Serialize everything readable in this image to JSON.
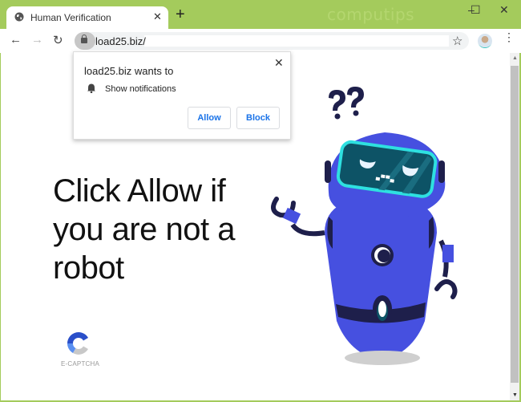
{
  "browser": {
    "tab_title": "Human Verification",
    "tab_close": "✕",
    "new_tab": "+",
    "watermark": "computips",
    "window_controls": {
      "minimize": "–",
      "maximize": "☐",
      "close": "✕"
    },
    "nav": {
      "back": "←",
      "forward": "→",
      "reload": "↻"
    },
    "url": "load25.biz/",
    "bookmark_star": "☆",
    "menu": "⋮"
  },
  "permission_popup": {
    "title": "load25.biz wants to",
    "permission": "Show notifications",
    "close": "✕",
    "allow_label": "Allow",
    "block_label": "Block"
  },
  "page": {
    "headline": "Click Allow if you are not a robot",
    "captcha_label": "E-CAPTCHA",
    "robot_question_marks": "??"
  },
  "colors": {
    "titlebar": "#a4cb5c",
    "robot_body": "#4650e0",
    "robot_dark": "#1e1f4b",
    "visor": "#0d5366",
    "visor_border": "#2ee0e0",
    "button_text": "#1a73e8"
  }
}
